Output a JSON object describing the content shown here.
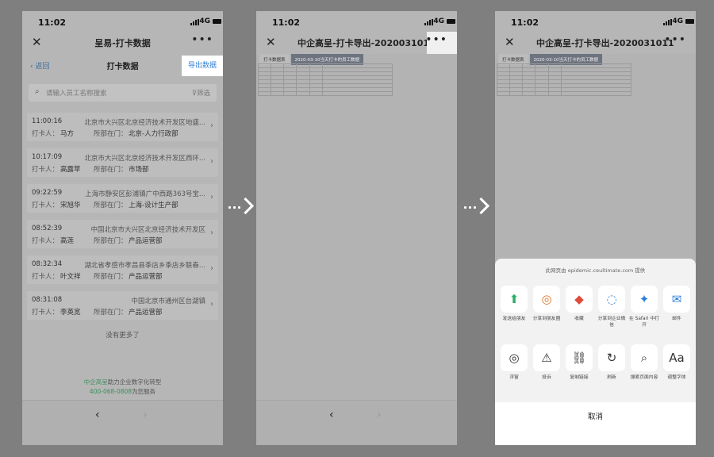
{
  "status": {
    "time": "11:02",
    "network": "4G"
  },
  "phone1": {
    "window_title": "呈易-打卡数据",
    "back_label": "返回",
    "nav_title": "打卡数据",
    "export_label": "导出数据",
    "search_placeholder": "请输入员工名称搜索",
    "filter_label": "筛选",
    "records": [
      {
        "time": "11:00:16",
        "address": "北京市大兴区北京经济技术开发区地盛...",
        "person_label": "打卡人：",
        "person": "马方",
        "dept_label": "所部在门：",
        "dept": "北京-人力行政部"
      },
      {
        "time": "10:17:09",
        "address": "北京市大兴区北京经济技术开发区西环...",
        "person_label": "打卡人：",
        "person": "高露苹",
        "dept_label": "所部在门：",
        "dept": "市场部"
      },
      {
        "time": "09:22:59",
        "address": "上海市静安区彭浦镇广中西路363号宝...",
        "person_label": "打卡人：",
        "person": "宋旭华",
        "dept_label": "所部在门：",
        "dept": "上海-设计生产部"
      },
      {
        "time": "08:52:39",
        "address": "中国北京市大兴区北京经济技术开发区",
        "person_label": "打卡人：",
        "person": "高莲",
        "dept_label": "所部在门：",
        "dept": "产品运营部"
      },
      {
        "time": "08:32:34",
        "address": "湖北省孝感市孝昌县季店乡季店乡联春...",
        "person_label": "打卡人：",
        "person": "叶文祥",
        "dept_label": "所部在门：",
        "dept": "产品运营部"
      },
      {
        "time": "08:31:08",
        "address": "中国北京市通州区台湖镇",
        "person_label": "打卡人：",
        "person": "李英宽",
        "dept_label": "所部在门：",
        "dept": "产品运营部"
      }
    ],
    "no_more": "没有更多了",
    "brand_name": "中企高呈",
    "brand_tail": "助力企业数字化转型",
    "hotline": "400-068-0808",
    "hotline_tail": "为您服务"
  },
  "phone2": {
    "window_title": "中企高呈-打卡导出-20200310111...",
    "sheet_tabs": [
      "打卡数据表",
      "2020-03-10当天打卡的员工数据"
    ]
  },
  "phone3": {
    "window_title": "中企高呈-打卡导出-20200310111...",
    "sheet_tabs": [
      "打卡数据表",
      "2020-03-10当天打卡的员工数据"
    ],
    "provider": "此网页由 epidemic.ceultimate.com 提供",
    "share_row1": [
      {
        "label": "发送给朋友",
        "icon": "send-icon",
        "glyph": "⬆",
        "color": "#2aae67"
      },
      {
        "label": "分享到朋友圈",
        "icon": "moments-icon",
        "glyph": "◎",
        "color": "#e0742f"
      },
      {
        "label": "收藏",
        "icon": "favorite-icon",
        "glyph": "◆",
        "color": "#e04b3b"
      },
      {
        "label": "分享到企业微信",
        "icon": "wecom-icon",
        "glyph": "◌",
        "color": "#3a86d6"
      },
      {
        "label": "在 Safari 中打开",
        "icon": "safari-icon",
        "glyph": "✦",
        "color": "#2b7de0"
      },
      {
        "label": "邮件",
        "icon": "mail-icon",
        "glyph": "✉",
        "color": "#2b7de0"
      }
    ],
    "share_row2": [
      {
        "label": "浮窗",
        "icon": "float-window-icon",
        "glyph": "◎",
        "color": "#333333"
      },
      {
        "label": "投诉",
        "icon": "warning-icon",
        "glyph": "⚠",
        "color": "#333333"
      },
      {
        "label": "复制链接",
        "icon": "link-icon",
        "glyph": "⛓",
        "color": "#333333"
      },
      {
        "label": "刷新",
        "icon": "refresh-icon",
        "glyph": "↻",
        "color": "#333333"
      },
      {
        "label": "搜索页面内容",
        "icon": "search-icon",
        "glyph": "⌕",
        "color": "#333333"
      },
      {
        "label": "调整字体",
        "icon": "font-icon",
        "glyph": "Aa",
        "color": "#333333"
      }
    ],
    "cancel_label": "取消"
  }
}
